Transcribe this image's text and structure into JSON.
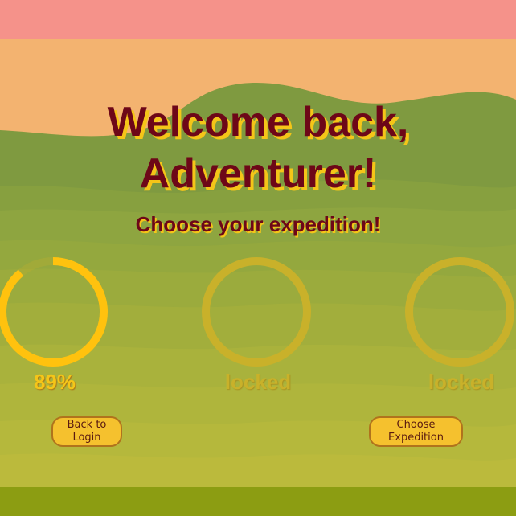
{
  "welcome": {
    "line1": "Welcome back,",
    "line2": "Adventurer!"
  },
  "subtitle": "Choose your expedition!",
  "levels": [
    {
      "status": "89%",
      "progress_percent": 89,
      "locked": false
    },
    {
      "status": "locked",
      "locked": true
    },
    {
      "status": "locked",
      "locked": true
    }
  ],
  "buttons": {
    "back": "Back to\nLogin",
    "choose": "Choose\nExpedition"
  },
  "colors": {
    "sky_top": "#f5928a",
    "sky": "#f3b370",
    "title": "#6d0718",
    "title_shadow": "#f5c518",
    "ring_active": "#ffc20e",
    "ring_locked": "#c9b12a",
    "button_fill": "#f5c12e",
    "button_border": "#b0731c"
  }
}
